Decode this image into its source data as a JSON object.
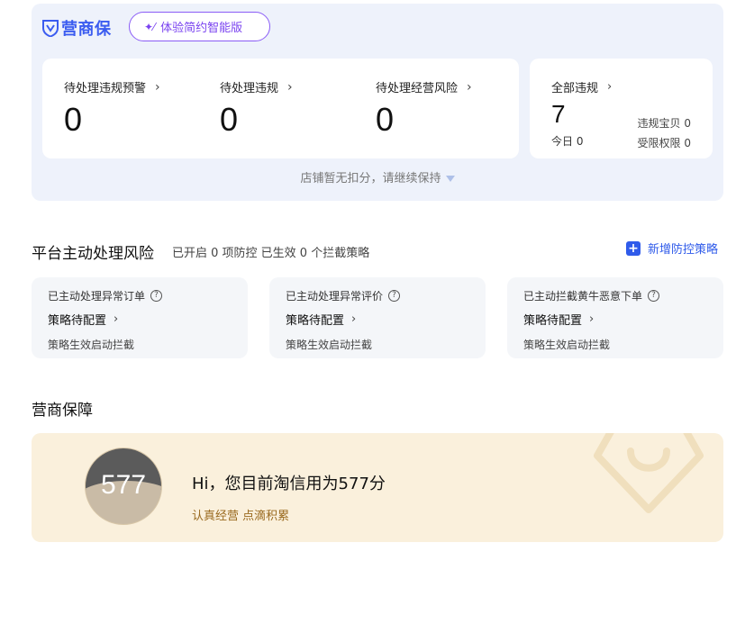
{
  "brand": {
    "name": "营商保",
    "logo_icon": "shield-v-icon",
    "accent": "#3b5cf0"
  },
  "trial_button": {
    "label": "体验简约智能版",
    "icon": "sparkle-wand-icon"
  },
  "stats": [
    {
      "label": "待处理违规预警",
      "value": "0"
    },
    {
      "label": "待处理违规",
      "value": "0"
    },
    {
      "label": "待处理经营风险",
      "value": "0"
    }
  ],
  "all_violations": {
    "label": "全部违规",
    "value": "7",
    "today_label": "今日",
    "today_value": "0",
    "baby_label": "违规宝贝",
    "baby_value": "0",
    "restricted_label": "受限权限",
    "restricted_value": "0"
  },
  "no_deduction_text": "店铺暂无扣分，请继续保持",
  "platform": {
    "title": "平台主动处理风险",
    "subtitle": "已开启 0 项防控 已生效 0 个拦截策略",
    "add_label": "新增防控策略",
    "cards": [
      {
        "title": "已主动处理异常订单",
        "config": "策略待配置",
        "note": "策略生效启动拦截"
      },
      {
        "title": "已主动处理异常评价",
        "config": "策略待配置",
        "note": "策略生效启动拦截"
      },
      {
        "title": "已主动拦截黄牛恶意下单",
        "config": "策略待配置",
        "note": "策略生效启动拦截"
      }
    ]
  },
  "guarantee": {
    "title": "营商保障",
    "score": "577",
    "headline": "Hi，您目前淘信用为577分",
    "sub": "认真经营 点滴积累",
    "card_color": "#faf0dc"
  }
}
